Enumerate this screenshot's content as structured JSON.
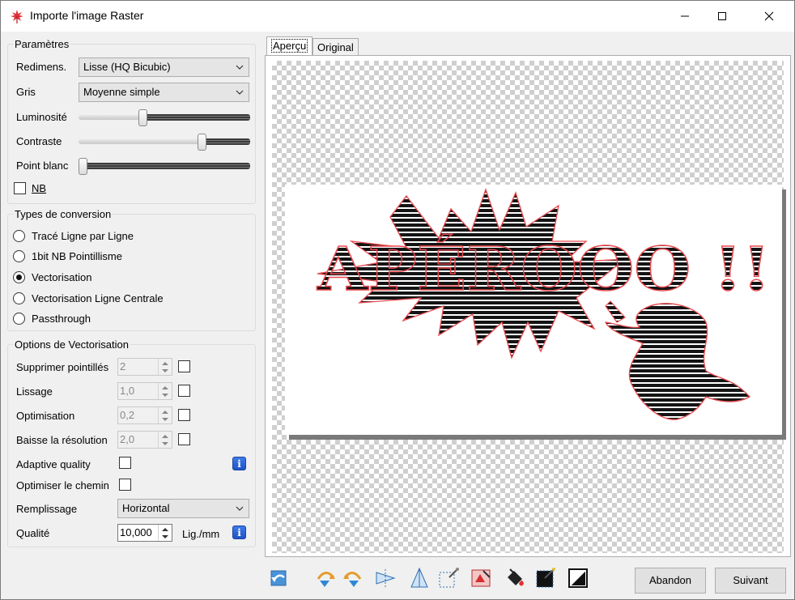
{
  "window": {
    "title": "Importe l'image Raster"
  },
  "params": {
    "legend": "Paramètres",
    "resize_label": "Redimens.",
    "resize_value": "Lisse (HQ Bicubic)",
    "gray_label": "Gris",
    "gray_value": "Moyenne simple",
    "brightness_label": "Luminosité",
    "brightness_level": 0.37,
    "contrast_label": "Contraste",
    "contrast_level": 0.73,
    "whitepoint_label": "Point blanc",
    "whitepoint_level": 0.0,
    "nb_label": "NB",
    "nb_checked": false
  },
  "types": {
    "legend": "Types de conversion",
    "options": [
      {
        "label": "Tracé Ligne par Ligne",
        "checked": false
      },
      {
        "label": "1bit NB Pointillisme",
        "checked": false
      },
      {
        "label": "Vectorisation",
        "checked": true
      },
      {
        "label": "Vectorisation Ligne Centrale",
        "checked": false
      },
      {
        "label": "Passthrough",
        "checked": false
      }
    ]
  },
  "vect": {
    "legend": "Options de Vectorisation",
    "remove_dots_label": "Supprimer pointillés",
    "remove_dots_value": "2",
    "smoothing_label": "Lissage",
    "smoothing_value": "1,0",
    "optimization_label": "Optimisation",
    "optimization_value": "0,2",
    "lower_res_label": "Baisse la résolution",
    "lower_res_value": "2,0",
    "adaptive_label": "Adaptive quality",
    "optimize_path_label": "Optimiser le chemin",
    "fill_label": "Remplissage",
    "fill_value": "Horizontal",
    "quality_label": "Qualité",
    "quality_value": "10,000",
    "quality_unit": "Lig./mm",
    "info_glyph": "i"
  },
  "tabs": [
    {
      "label": "Aperçu",
      "active": true
    },
    {
      "label": "Original",
      "active": false
    }
  ],
  "preview": {
    "image_text": "APÉROOO !!"
  },
  "toolbar_icons": [
    "rotate-back-icon",
    "rotate-right-icon",
    "rotate-left-icon",
    "flip-horizontal-icon",
    "flip-vertical-icon",
    "crop-icon",
    "invert-icon",
    "fill-bucket-icon",
    "select-icon",
    "brightness-icon"
  ],
  "buttons": {
    "cancel": "Abandon",
    "next": "Suivant"
  },
  "colors": {
    "accent_info": "#2a5fd6",
    "trace_outline": "#e8484d"
  }
}
